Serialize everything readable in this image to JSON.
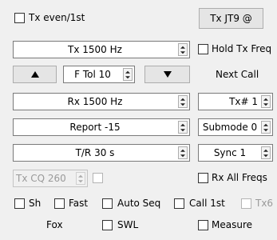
{
  "tx_even": {
    "label": "Tx even/1st"
  },
  "tx_mode_button": {
    "label": "Tx JT9 @"
  },
  "tx_freq": {
    "value": "Tx  1500 Hz"
  },
  "hold_tx_freq": {
    "label": "Hold Tx Freq"
  },
  "up_button": {
    "icon": "up-triangle-icon"
  },
  "ftol": {
    "value": "F Tol  10"
  },
  "down_button": {
    "icon": "down-triangle-icon"
  },
  "next_call": {
    "label": "Next Call"
  },
  "rx_freq": {
    "value": "Rx  1500 Hz"
  },
  "tx_number": {
    "value": "Tx# 1"
  },
  "report": {
    "value": "Report -15"
  },
  "submode": {
    "value": "Submode 0"
  },
  "tr_period": {
    "value": "T/R  30  s"
  },
  "sync": {
    "value": "Sync  1"
  },
  "tx_cq": {
    "value": "Tx CQ 260"
  },
  "rx_all_freqs": {
    "label": "Rx All Freqs"
  },
  "sh": {
    "label": "Sh"
  },
  "fast": {
    "label": "Fast"
  },
  "auto_seq": {
    "label": "Auto Seq"
  },
  "call_1st": {
    "label": "Call 1st"
  },
  "tx6": {
    "label": "Tx6"
  },
  "fox": {
    "label": "Fox"
  },
  "swl": {
    "label": "SWL"
  },
  "measure": {
    "label": "Measure"
  }
}
